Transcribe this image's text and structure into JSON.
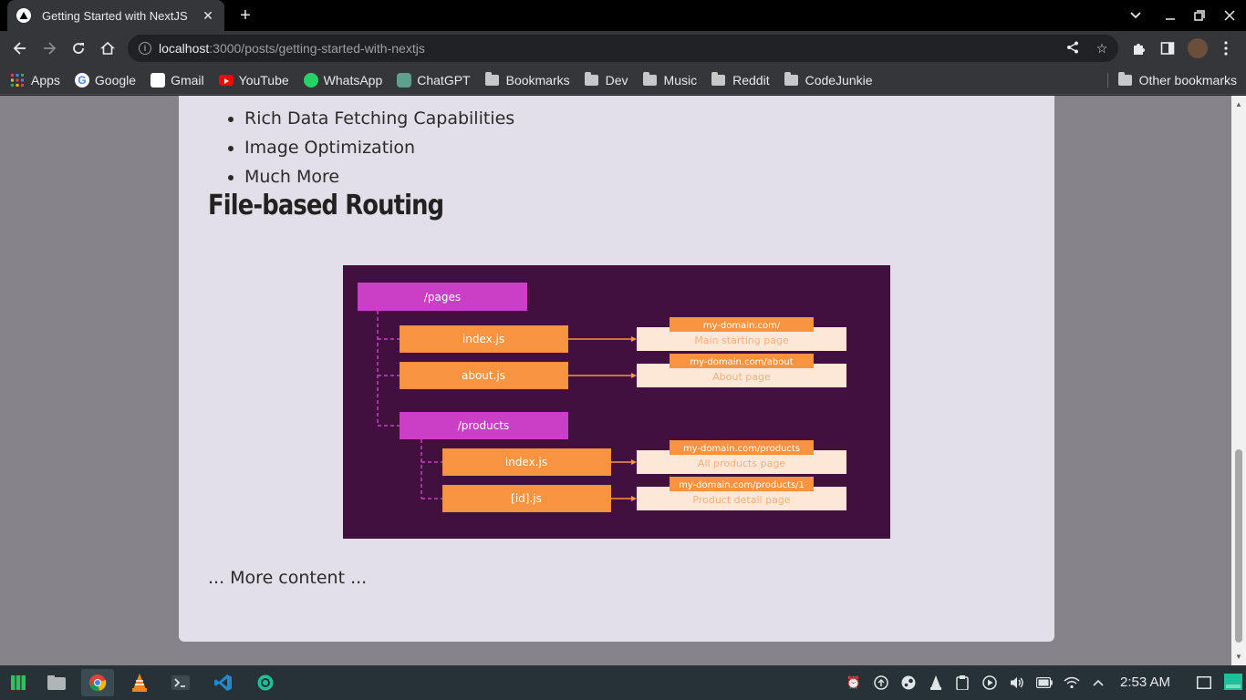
{
  "browser": {
    "tab_title": "Getting Started with NextJS",
    "tab_close": "✕",
    "new_tab": "+",
    "url_host": "localhost",
    "url_rest": ":3000/posts/getting-started-with-nextjs"
  },
  "bookmarks": {
    "items": [
      {
        "label": "Apps",
        "icon": "apps-grid-icon"
      },
      {
        "label": "Google",
        "icon": "google-icon"
      },
      {
        "label": "Gmail",
        "icon": "gmail-icon"
      },
      {
        "label": "YouTube",
        "icon": "youtube-icon"
      },
      {
        "label": "WhatsApp",
        "icon": "whatsapp-icon"
      },
      {
        "label": "ChatGPT",
        "icon": "chatgpt-icon"
      },
      {
        "label": "Bookmarks",
        "icon": "folder-icon"
      },
      {
        "label": "Dev",
        "icon": "folder-icon"
      },
      {
        "label": "Music",
        "icon": "folder-icon"
      },
      {
        "label": "Reddit",
        "icon": "folder-icon"
      },
      {
        "label": "CodeJunkie",
        "icon": "folder-icon"
      }
    ],
    "other": "Other bookmarks"
  },
  "article": {
    "features": [
      "Rich Data Fetching Capabilities",
      "Image Optimization",
      "Much More"
    ],
    "section_heading": "File-based Routing",
    "more_content": "... More content ..."
  },
  "diagram": {
    "pages_folder": "/pages",
    "products_folder": "/products",
    "files": [
      {
        "name": "index.js",
        "url": "my-domain.com/",
        "page": "Main starting page"
      },
      {
        "name": "about.js",
        "url": "my-domain.com/about",
        "page": "About page"
      },
      {
        "name": "index.js",
        "url": "my-domain.com/products",
        "page": "All products page"
      },
      {
        "name": "[id].js",
        "url": "my-domain.com/products/1",
        "page": "Product detail page"
      }
    ],
    "colors": {
      "background": "#42103f",
      "folder": "#c93fc6",
      "file": "#f89440",
      "target": "#fde7d6"
    }
  },
  "taskbar": {
    "time": "2:53 AM",
    "apps": [
      "manjaro-icon",
      "file-manager-icon",
      "chrome-icon",
      "vlc-icon",
      "terminal-icon",
      "vscode-icon",
      "aperture-icon"
    ]
  }
}
